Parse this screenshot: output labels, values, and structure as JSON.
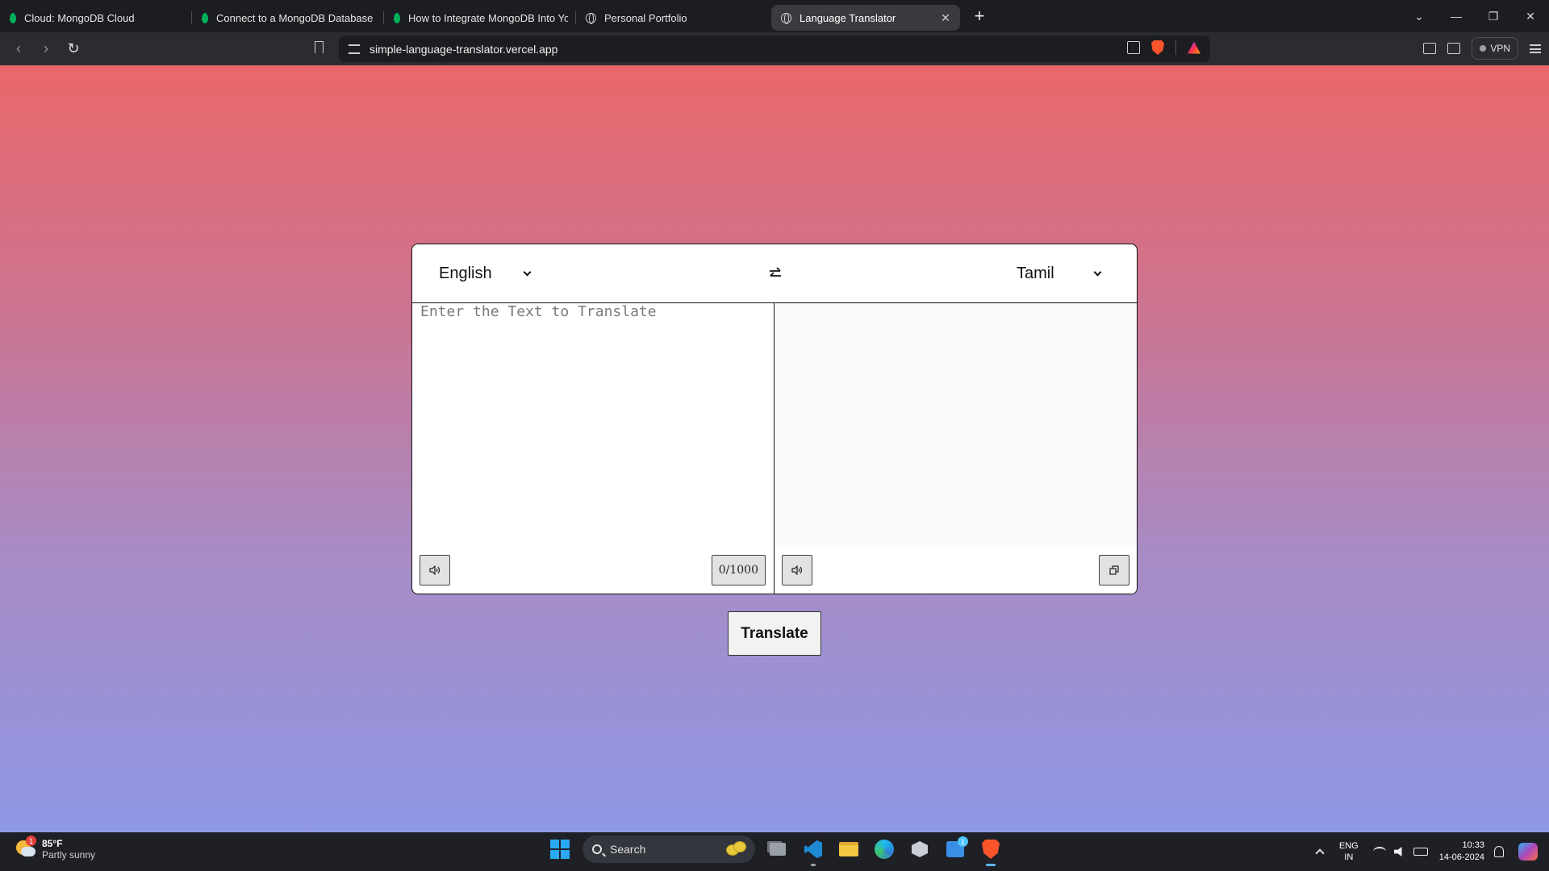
{
  "browser": {
    "tabs": [
      {
        "title": "Cloud: MongoDB Cloud",
        "favicon": "mongodb-leaf-icon",
        "active": false
      },
      {
        "title": "Connect to a MongoDB Database Us",
        "favicon": "mongodb-leaf-icon",
        "active": false
      },
      {
        "title": "How to Integrate MongoDB Into You",
        "favicon": "mongodb-leaf-icon",
        "active": false
      },
      {
        "title": "Personal Portfolio",
        "favicon": "globe-icon",
        "active": false
      },
      {
        "title": "Language Translator",
        "favicon": "globe-icon",
        "active": true
      }
    ],
    "url": "simple-language-translator.vercel.app",
    "vpn_label": "VPN"
  },
  "translator": {
    "from_language": "English",
    "to_language": "Tamil",
    "input_placeholder": "Enter the Text to Translate",
    "input_value": "",
    "output_value": "",
    "char_counter": "0/1000",
    "translate_button": "Translate"
  },
  "taskbar": {
    "weather_temp": "85°F",
    "weather_desc": "Partly sunny",
    "weather_badge": "1",
    "search_label": "Search",
    "store_badge": "1",
    "lang_line1": "ENG",
    "lang_line2": "IN",
    "time": "10:33",
    "date": "14-06-2024"
  },
  "colors": {
    "gradient_top": "#e9676a",
    "gradient_bottom": "#8f98e6",
    "accent_brave": "#fb542b"
  }
}
